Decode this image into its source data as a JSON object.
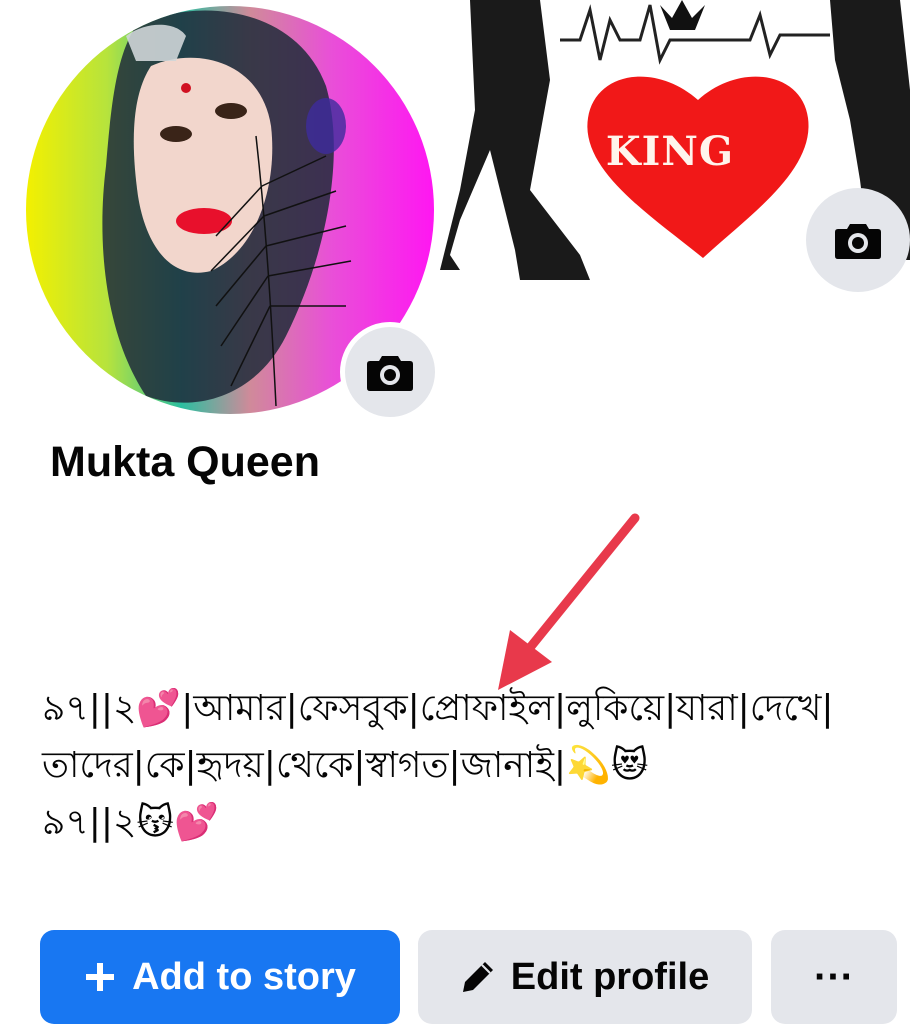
{
  "cover": {
    "badge_text": "KING"
  },
  "profile": {
    "name": "Mukta Queen",
    "bio": "৯৭||২💕|আমার|ফেসবুক|প্রোফাইল|লুকিয়ে|যারা|দেখে|তাদের|কে|হৃদয়|থেকে|স্বাগত|জানাই|💫😻\n৯৭||২😽💕"
  },
  "actions": {
    "add_story_label": "Add to story",
    "edit_profile_label": "Edit profile",
    "more_label": "···"
  },
  "colors": {
    "primary": "#1877f2",
    "secondary_button": "#e4e6eb",
    "annotation_arrow": "#e8394b",
    "heart": "#f11818"
  },
  "icons": {
    "cover_camera": "camera-icon",
    "avatar_camera": "camera-icon",
    "add": "plus-icon",
    "edit": "pencil-icon",
    "more": "more-dots-icon"
  }
}
